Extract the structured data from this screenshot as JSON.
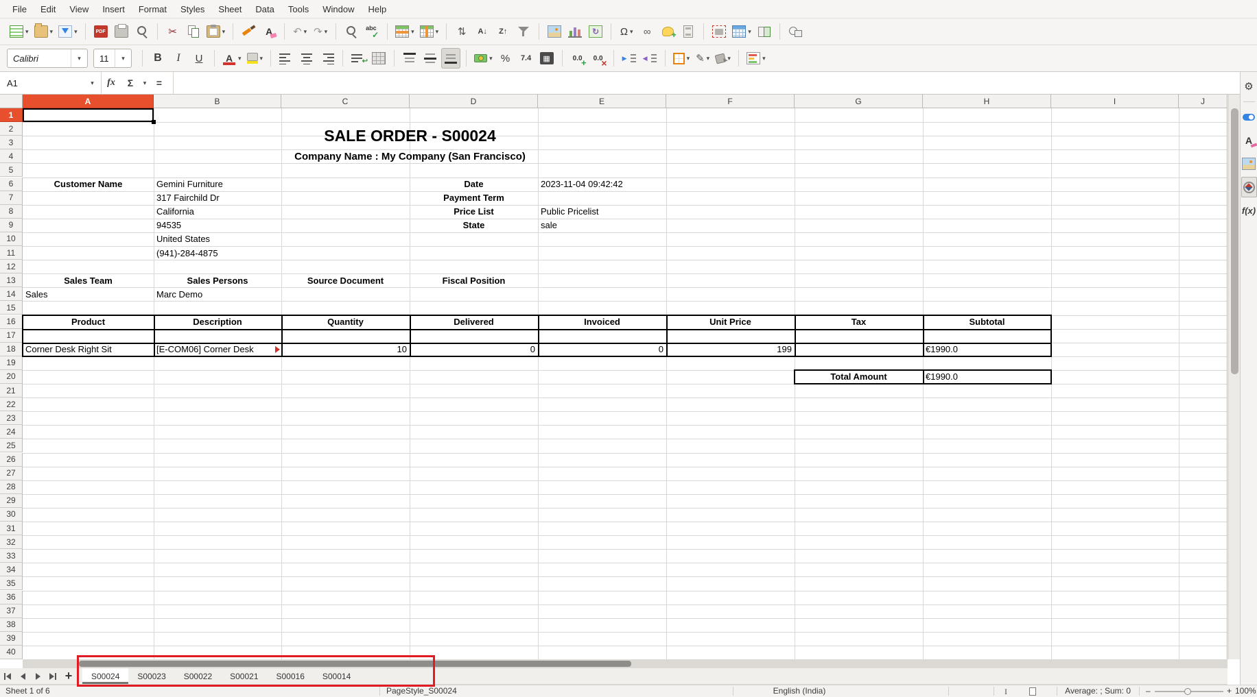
{
  "colors": {
    "accent_selected_header": "#e8502d",
    "annotation": "#e01b24",
    "table_border": "#000000",
    "chrome": "#f6f5f3"
  },
  "menu": {
    "items": [
      "File",
      "Edit",
      "View",
      "Insert",
      "Format",
      "Styles",
      "Sheet",
      "Data",
      "Tools",
      "Window",
      "Help"
    ]
  },
  "toolbar_main": {
    "items": [
      {
        "name": "new-document",
        "icon": "doc",
        "dd": true
      },
      {
        "name": "open",
        "icon": "folder",
        "dd": true
      },
      {
        "name": "save",
        "icon": "save",
        "dd": true
      },
      {
        "sep": true
      },
      {
        "name": "export-pdf",
        "icon": "pdf",
        "glyph": "PDF"
      },
      {
        "name": "print",
        "icon": "printer"
      },
      {
        "name": "print-preview",
        "icon": "mag"
      },
      {
        "sep": true
      },
      {
        "name": "cut",
        "glyph": "✂",
        "color": "#8a2f2f"
      },
      {
        "name": "copy",
        "icon": "copy"
      },
      {
        "name": "paste",
        "icon": "paste",
        "dd": true
      },
      {
        "sep": true
      },
      {
        "name": "clone-formatting",
        "icon": "brushbar"
      },
      {
        "name": "clear-formatting",
        "icon": "clearfmt"
      },
      {
        "sep": true
      },
      {
        "name": "undo",
        "glyph": "↶",
        "color": "#9a9a9a",
        "dd": true
      },
      {
        "name": "redo",
        "glyph": "↷",
        "color": "#9a9a9a",
        "dd": true
      },
      {
        "sep": true
      },
      {
        "name": "find-and-replace",
        "icon": "mag"
      },
      {
        "name": "spelling",
        "icon": "spell"
      },
      {
        "sep": true
      },
      {
        "name": "row",
        "icon": "table rows",
        "dd": true
      },
      {
        "name": "column",
        "icon": "table cols",
        "dd": true
      },
      {
        "sep": true
      },
      {
        "name": "sort",
        "glyph": "⇅",
        "color": "#555555"
      },
      {
        "name": "sort-ascending",
        "glyph": "A↓",
        "gcls": "small"
      },
      {
        "name": "sort-descending",
        "glyph": "Z↑",
        "gcls": "small"
      },
      {
        "name": "autofilter",
        "icon": "funnel"
      },
      {
        "sep": true
      },
      {
        "name": "insert-image",
        "icon": "image"
      },
      {
        "name": "insert-chart",
        "icon": "chart"
      },
      {
        "name": "insert-pivot-table",
        "icon": "pivot",
        "glyph": "↻"
      },
      {
        "sep": true
      },
      {
        "name": "special-character",
        "glyph": "Ω",
        "color": "#3a3a3a",
        "dd": true
      },
      {
        "name": "insert-hyperlink",
        "glyph": "∞",
        "color": "#5a5a5a"
      },
      {
        "name": "insert-comment",
        "icon": "bubble"
      },
      {
        "name": "headers-and-footers",
        "icon": "page"
      },
      {
        "sep": true
      },
      {
        "name": "print-area",
        "icon": "printarea"
      },
      {
        "name": "freeze-rows-and-columns",
        "icon": "table freeze",
        "dd": true
      },
      {
        "name": "split-window",
        "icon": "split"
      },
      {
        "sep": true
      },
      {
        "name": "show-draw-functions",
        "icon": "shapes"
      }
    ]
  },
  "toolbar_format": {
    "items": [
      {
        "name": "font-name",
        "combo": "Calibri",
        "w": 118,
        "italic": true
      },
      {
        "name": "font-size",
        "combo": "11",
        "w": 56
      },
      {
        "sep": true
      },
      {
        "name": "bold",
        "glyph": "B",
        "gcls": "fb"
      },
      {
        "name": "italic",
        "glyph": "I",
        "gcls": "fi"
      },
      {
        "name": "underline",
        "glyph": "U",
        "gcls": "fu"
      },
      {
        "sep": true
      },
      {
        "name": "font-color",
        "icon": "fontcolor",
        "dd": true
      },
      {
        "name": "highlighting-color",
        "icon": "highlight",
        "dd": true
      },
      {
        "sep": true
      },
      {
        "name": "align-left",
        "icon": "bars left"
      },
      {
        "name": "align-center",
        "icon": "bars center"
      },
      {
        "name": "align-right",
        "icon": "bars right"
      },
      {
        "sep": true
      },
      {
        "name": "wrap-text",
        "icon": "wrap"
      },
      {
        "name": "merge-cells",
        "icon": "table merge"
      },
      {
        "sep": true
      },
      {
        "name": "align-top",
        "icon": "valign top"
      },
      {
        "name": "center-vertically",
        "icon": "valign mid"
      },
      {
        "name": "align-bottom",
        "icon": "valign bot",
        "active": true
      },
      {
        "sep": true
      },
      {
        "name": "currency-format",
        "icon": "money",
        "dd": true
      },
      {
        "name": "percent-format",
        "glyph": "%",
        "color": "#3a3a3a"
      },
      {
        "name": "number-format",
        "glyph": "7.4",
        "gcls": "num"
      },
      {
        "name": "date-format",
        "icon": "cal",
        "glyph": "▦"
      },
      {
        "sep": true
      },
      {
        "name": "add-decimal-place",
        "icon": "dec add"
      },
      {
        "name": "delete-decimal-place",
        "icon": "dec del"
      },
      {
        "sep": true
      },
      {
        "name": "increase-indent",
        "icon": "indent inc"
      },
      {
        "name": "decrease-indent",
        "icon": "indent dec"
      },
      {
        "sep": true
      },
      {
        "name": "borders",
        "icon": "borders",
        "dd": true
      },
      {
        "name": "border-style",
        "glyph": "✎",
        "color": "#555555",
        "dd": true
      },
      {
        "name": "background-color",
        "icon": "paintcan",
        "dd": true
      },
      {
        "sep": true
      },
      {
        "name": "conditional-formatting",
        "icon": "condfmt",
        "dd": true
      }
    ]
  },
  "formula_bar": {
    "cell_reference": "A1",
    "function_wizard": "fx",
    "sum": "Σ",
    "equals": "=",
    "input_value": "",
    "expand": "▾"
  },
  "sheet": {
    "columns": [
      "A",
      "B",
      "C",
      "D",
      "E",
      "F",
      "G",
      "H",
      "I",
      "J"
    ],
    "row_count": 40,
    "selection": {
      "cell": "A1",
      "row": 1,
      "col": 1
    },
    "cells": [
      {
        "r": 2,
        "c": 2,
        "span": 4,
        "rowspan": 2,
        "text": "SALE ORDER - S00024",
        "b": 1,
        "align": "center",
        "cls": "title"
      },
      {
        "r": 4,
        "c": 2,
        "span": 4,
        "text": "Company Name : My Company (San Francisco)",
        "b": 1,
        "align": "center",
        "cls": "subtitle"
      },
      {
        "r": 6,
        "c": 1,
        "text": "Customer Name",
        "b": 1,
        "align": "center"
      },
      {
        "r": 6,
        "c": 2,
        "text": "Gemini Furniture"
      },
      {
        "r": 6,
        "c": 4,
        "text": "Date",
        "b": 1,
        "align": "center"
      },
      {
        "r": 6,
        "c": 5,
        "span": 2,
        "text": "2023-11-04 09:42:42"
      },
      {
        "r": 7,
        "c": 2,
        "text": "317 Fairchild Dr"
      },
      {
        "r": 7,
        "c": 4,
        "text": "Payment Term",
        "b": 1,
        "align": "center"
      },
      {
        "r": 8,
        "c": 2,
        "text": "California"
      },
      {
        "r": 8,
        "c": 4,
        "text": "Price List",
        "b": 1,
        "align": "center"
      },
      {
        "r": 8,
        "c": 5,
        "text": "Public Pricelist"
      },
      {
        "r": 9,
        "c": 2,
        "text": "94535"
      },
      {
        "r": 9,
        "c": 4,
        "text": "State",
        "b": 1,
        "align": "center"
      },
      {
        "r": 9,
        "c": 5,
        "text": "sale"
      },
      {
        "r": 10,
        "c": 2,
        "text": "United States"
      },
      {
        "r": 11,
        "c": 2,
        "text": "(941)-284-4875"
      },
      {
        "r": 13,
        "c": 1,
        "text": "Sales Team",
        "b": 1,
        "align": "center"
      },
      {
        "r": 13,
        "c": 2,
        "text": "Sales Persons",
        "b": 1,
        "align": "center"
      },
      {
        "r": 13,
        "c": 3,
        "text": "Source Document",
        "b": 1,
        "align": "center"
      },
      {
        "r": 13,
        "c": 4,
        "text": "Fiscal Position",
        "b": 1,
        "align": "center"
      },
      {
        "r": 14,
        "c": 1,
        "text": "Sales"
      },
      {
        "r": 14,
        "c": 2,
        "text": "Marc Demo"
      },
      {
        "r": 16,
        "c": 1,
        "text": "Product",
        "b": 1,
        "align": "center"
      },
      {
        "r": 16,
        "c": 2,
        "text": "Description",
        "b": 1,
        "align": "center"
      },
      {
        "r": 16,
        "c": 3,
        "text": "Quantity",
        "b": 1,
        "align": "center"
      },
      {
        "r": 16,
        "c": 4,
        "text": "Delivered",
        "b": 1,
        "align": "center"
      },
      {
        "r": 16,
        "c": 5,
        "text": "Invoiced",
        "b": 1,
        "align": "center"
      },
      {
        "r": 16,
        "c": 6,
        "text": "Unit Price",
        "b": 1,
        "align": "center"
      },
      {
        "r": 16,
        "c": 7,
        "text": "Tax",
        "b": 1,
        "align": "center"
      },
      {
        "r": 16,
        "c": 8,
        "text": "Subtotal",
        "b": 1,
        "align": "center"
      },
      {
        "r": 18,
        "c": 1,
        "text": "Corner Desk Right Sit"
      },
      {
        "r": 18,
        "c": 2,
        "text": "[E-COM06] Corner Desk",
        "overflow": true
      },
      {
        "r": 18,
        "c": 3,
        "text": "10",
        "align": "right"
      },
      {
        "r": 18,
        "c": 4,
        "text": "0",
        "align": "right"
      },
      {
        "r": 18,
        "c": 5,
        "text": "0",
        "align": "right"
      },
      {
        "r": 18,
        "c": 6,
        "text": "199",
        "align": "right"
      },
      {
        "r": 18,
        "c": 8,
        "text": "€1990.0"
      },
      {
        "r": 20,
        "c": 7,
        "text": "Total Amount",
        "b": 1,
        "align": "center"
      },
      {
        "r": 20,
        "c": 8,
        "text": "€1990.0"
      }
    ],
    "table_ranges": [
      {
        "r1": 16,
        "r2": 18,
        "c1": 1,
        "c2": 8
      },
      {
        "r1": 20,
        "r2": 20,
        "c1": 7,
        "c2": 8
      }
    ]
  },
  "tabbar": {
    "nav": [
      {
        "name": "first-sheet",
        "dir": "left",
        "bar": true
      },
      {
        "name": "previous-sheet",
        "dir": "left"
      },
      {
        "name": "next-sheet",
        "dir": "right"
      },
      {
        "name": "last-sheet",
        "dir": "right",
        "bar": true
      }
    ],
    "add_label": "+",
    "tabs": [
      {
        "label": "S00024",
        "active": true
      },
      {
        "label": "S00023"
      },
      {
        "label": "S00022"
      },
      {
        "label": "S00021"
      },
      {
        "label": "S00016"
      },
      {
        "label": "S00014"
      }
    ]
  },
  "sidebar": {
    "items": [
      {
        "name": "sidebar-settings",
        "glyph": "⚙"
      },
      {
        "sep": true
      },
      {
        "name": "properties-deck",
        "icon": "pill"
      },
      {
        "name": "styles-deck",
        "icon": "styles"
      },
      {
        "name": "gallery-deck",
        "icon": "image"
      },
      {
        "name": "navigator-deck",
        "icon": "compass",
        "active": true
      },
      {
        "name": "functions-deck",
        "glyph": "f(x)",
        "gcls": "fx"
      }
    ]
  },
  "statusbar": {
    "sheet_info": "Sheet 1 of 6",
    "page_style": "PageStyle_S00024",
    "language": "English (India)",
    "selection_mode": "I",
    "average_sum": "Average: ; Sum: 0",
    "zoom_minus": "–",
    "zoom_plus": "+",
    "zoom_percent": "100%"
  }
}
